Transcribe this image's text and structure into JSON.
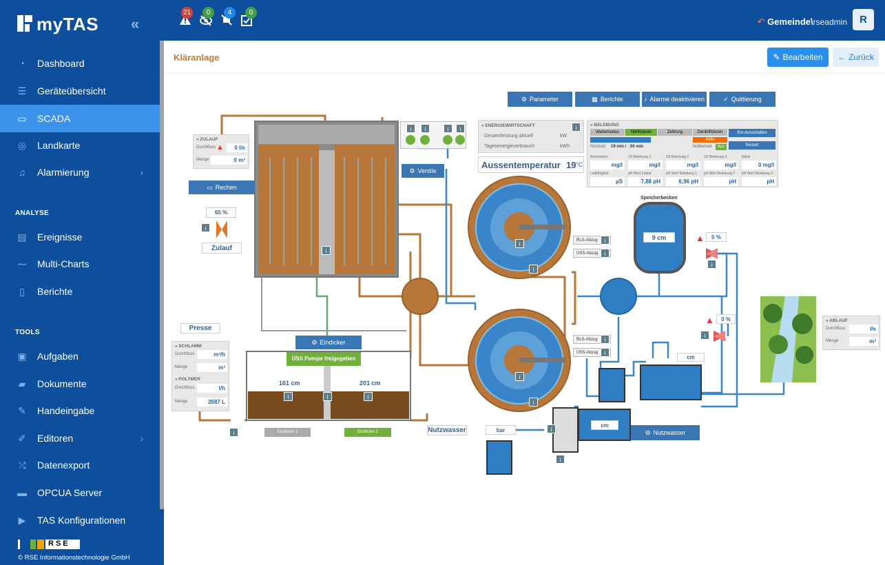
{
  "app": {
    "name": "myTAS"
  },
  "topbar": {
    "badges": [
      {
        "icon": "warning-icon",
        "count": "21",
        "color": "#e53935"
      },
      {
        "icon": "eye-off-icon",
        "count": "0",
        "color": "#43a047"
      },
      {
        "icon": "bell-off-icon",
        "count": "4",
        "color": "#1e88e5"
      },
      {
        "icon": "task-check-icon",
        "count": "0",
        "color": "#43a047"
      }
    ],
    "user_domain": "Gemeinde\\",
    "user_name": "rseadmin",
    "avatar_letter": "R"
  },
  "sidebar": {
    "items": [
      {
        "label": "Dashboard",
        "icon": "dashboard-icon"
      },
      {
        "label": "Geräteübersicht",
        "icon": "list-icon"
      },
      {
        "label": "SCADA",
        "icon": "monitor-icon",
        "active": true
      },
      {
        "label": "Landkarte",
        "icon": "map-pin-icon"
      },
      {
        "label": "Alarmierung",
        "icon": "bell-icon",
        "chevron": true
      }
    ],
    "analyse_header": "ANALYSE",
    "analyse_items": [
      {
        "label": "Ereignisse",
        "icon": "events-icon"
      },
      {
        "label": "Multi-Charts",
        "icon": "chart-icon"
      },
      {
        "label": "Berichte",
        "icon": "report-icon"
      }
    ],
    "tools_header": "TOOLS",
    "tools_items": [
      {
        "label": "Aufgaben",
        "icon": "calendar-check-icon"
      },
      {
        "label": "Dokumente",
        "icon": "folder-icon"
      },
      {
        "label": "Handeingabe",
        "icon": "pencil-icon"
      },
      {
        "label": "Editoren",
        "icon": "editor-icon",
        "chevron": true
      },
      {
        "label": "Datenexport",
        "icon": "shuffle-icon"
      },
      {
        "label": "OPCUA Server",
        "icon": "server-icon"
      },
      {
        "label": "TAS Konfigurationen",
        "icon": "config-icon"
      }
    ],
    "footer_copyright": "© RSE Informationstechnologie GmbH",
    "footer_logo_text": "RSE"
  },
  "page": {
    "title": "Kläranlage",
    "edit_label": "Bearbeiten",
    "back_label": "Zurück"
  },
  "toolbar": {
    "parameter": "Parameter",
    "berichte": "Berichte",
    "alarme": "Alarme deaktivieren",
    "quittierung": "Quittierung"
  },
  "zulauf": {
    "title": "» ZULAUF",
    "durchfluss_label": "Durchfluss",
    "durchfluss_value": "0 l/s",
    "menge_label": "Menge",
    "menge_value": "0 m³",
    "rechen_label": "Rechen",
    "percent": "65 %",
    "label": "Zulauf"
  },
  "ventile": {
    "label": "Ventile"
  },
  "energie": {
    "title": "» ENERGIEWIRTSCHAFT",
    "gesamtleistung_label": "Gesamtleistung aktuell",
    "gesamtleistung_unit": "kW",
    "tagesenergie_label": "Tagesenergieverbrauch",
    "tagesenergie_unit": "kWh",
    "aussentemp_label": "Aussentemperatur",
    "aussentemp_value": "19",
    "aussentemp_unit": "°C"
  },
  "belebung": {
    "title": "» BELEBUNG",
    "tabs": [
      "Wartemodus",
      "Nitrifizieren",
      "Zehrung",
      "Denitrifizieren"
    ],
    "aktiv": "Aktiv",
    "aus": "Aus",
    "restzeit_label": "Restzeit:",
    "restzeit_value": "19 min /",
    "restzeit_total": "50 min",
    "notbetrieb_label": "Notbetrieb",
    "ein_ausschalten": "Ein-Ausschalten",
    "restart": "Restart",
    "row1_labels": [
      "Ammonium",
      "O2 Belebung 1",
      "O2 Belebung 2",
      "O2 Belebung 3",
      "Nitrat"
    ],
    "row1_units": [
      "mg/l",
      "mg/l",
      "mg/l",
      "mg/l",
      "mg/l"
    ],
    "nitrat_value": "0",
    "row2_labels": [
      "Leitfähigkeit",
      "pH Wert Zulauf",
      "pH Wert Belebung 1",
      "pH Wert Belebung 2",
      "pH Wert Belebung 3"
    ],
    "row2_units": [
      "µS",
      "pH",
      "pH",
      "pH",
      "pH"
    ],
    "ph_zulauf": "7,88",
    "ph_belebung1": "6,96"
  },
  "speicherbecken": {
    "label": "Speicherbecken",
    "value": "9 cm"
  },
  "valves": {
    "top_percent": "0 %",
    "bottom_percent": "0 %"
  },
  "ablauf": {
    "title": "» ABLAUF",
    "durchfluss_label": "Durchfluss",
    "durchfluss_unit": "l/s",
    "menge_label": "Menge",
    "menge_unit": "m³"
  },
  "rls": {
    "rls1": "RLS-Abzug",
    "uss1": "ÜSS-Abzug",
    "rls2": "RLS-Abzug",
    "uss2": "ÜSS-Abzug"
  },
  "presse": {
    "label": "Presse"
  },
  "schlamm": {
    "title": "» SCHLAMM",
    "durchfluss_label": "Durchfluss",
    "durchfluss_unit": "m³/h",
    "menge_label": "Menge",
    "menge_unit": "m³",
    "polymer_title": "» POLYMER",
    "polymer_durchfluss_label": "Durchfluss",
    "polymer_durchfluss_unit": "l/h",
    "polymer_menge_label": "Menge",
    "polymer_menge_value": "2687 L"
  },
  "eindicker": {
    "label": "Eindicker",
    "uss_pumpe": "ÜSS Pumpe freigegeben",
    "level1": "161 cm",
    "level2": "201 cm",
    "e1_label": "Eindicker 1",
    "e2_label": "Eindicker 2"
  },
  "nutzwasser": {
    "label": "Nutzwasser",
    "pressure_unit": "bar",
    "btn_label": "Nutzwasser",
    "cm_unit": "cm"
  },
  "misc": {
    "cm_unit": "cm"
  },
  "colors": {
    "brown": "#b8773a",
    "blue": "#3a84c9",
    "green": "#6fb13a",
    "dark_blue": "#0d4f9c"
  }
}
